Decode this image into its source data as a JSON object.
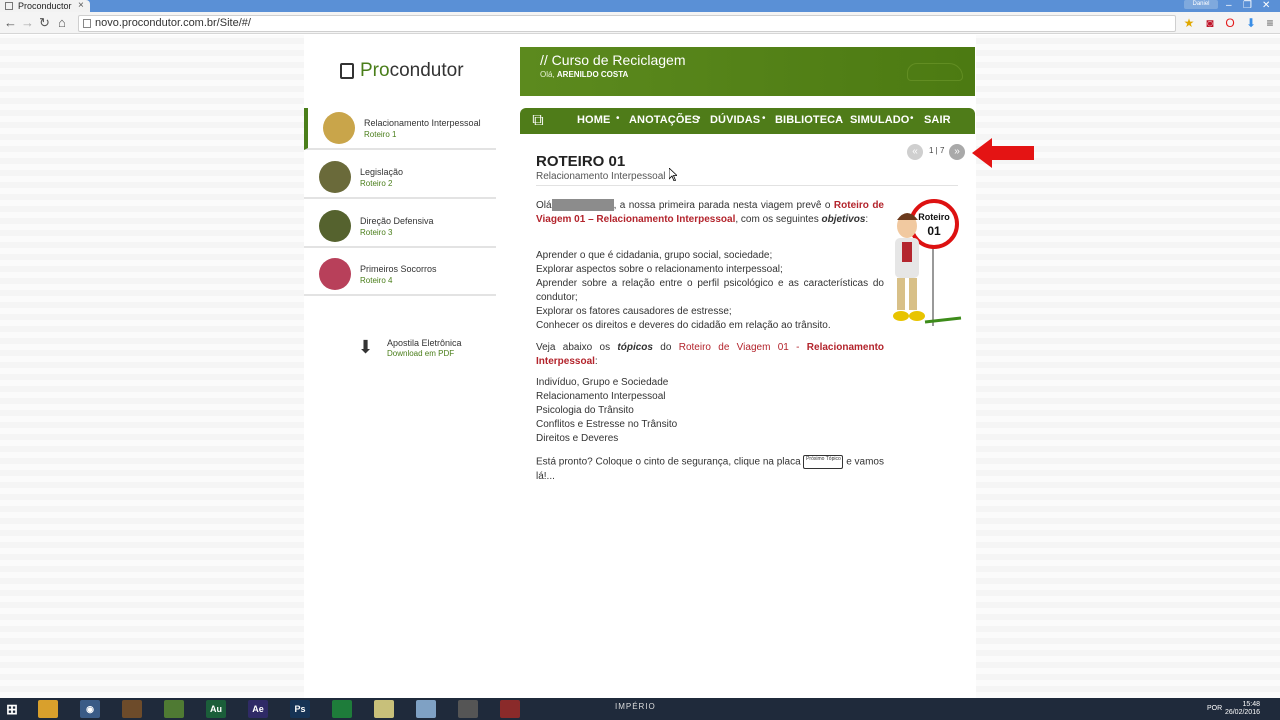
{
  "browser": {
    "tab_title": "Proconductor",
    "tab_close": "×",
    "address": "novo.procondutor.com.br/Site/#/",
    "user_badge": "Daniel",
    "window_controls": [
      "–",
      "❐",
      "✕"
    ]
  },
  "site": {
    "logo_text_green": "Pro",
    "logo_text_dark": "condutor",
    "banner_title": "// Curso de Reciclagem",
    "banner_greeting": "Olá,",
    "banner_user": "ARENILDO COSTA"
  },
  "nav": {
    "items": [
      "HOME",
      "ANOTAÇÕES",
      "DÚVIDAS",
      "BIBLIOTECA",
      "SIMULADO",
      "SAIR"
    ]
  },
  "sidebar": {
    "items": [
      {
        "title": "Relacionamento Interpessoal",
        "subtitle": "Roteiro 1"
      },
      {
        "title": "Legislação",
        "subtitle": "Roteiro 2"
      },
      {
        "title": "Direção Defensiva",
        "subtitle": "Roteiro 3"
      },
      {
        "title": "Primeiros Socorros",
        "subtitle": "Roteiro 4"
      }
    ],
    "download_title": "Apostila Eletrônica",
    "download_sub": "Download em PDF"
  },
  "content": {
    "title": "ROTEIRO 01",
    "subtitle": "Relacionamento Interpessoal",
    "pager": "1 | 7",
    "intro_pre": "Olá",
    "intro_mid": ", a nossa primeira parada nesta viagem prevê o",
    "intro_link": "Roteiro de Viagem 01 – Relacionamento Interpessoal",
    "intro_post": ", com os seguintes",
    "intro_obj": "objetivos",
    "objectives": [
      "Aprender o que é cidadania, grupo social, sociedade;",
      "Explorar aspectos sobre o relacionamento interpessoal;",
      "Aprender sobre a relação entre o perfil psicológico e as características do condutor;",
      "Explorar os fatores causadores de estresse;",
      "Conhecer os direitos e deveres do cidadão em relação ao trânsito."
    ],
    "topics_pre": "Veja abaixo os",
    "topics_word": "tópicos",
    "topics_do": "do",
    "topics_link1": "Roteiro de Viagem 01 -",
    "topics_link2": "Relacionamento Interpessoal",
    "topics": [
      "Indivíduo, Grupo e Sociedade",
      "Relacionamento Interpessoal",
      "Psicologia do Trânsito",
      "Conflitos e Estresse no Trânsito",
      "Direitos e Deveres"
    ],
    "closing_pre": "Está pronto? Coloque o cinto de segurança, clique na placa",
    "closing_post": "e vamos lá!...",
    "placa_text": "Próximo Tópico",
    "sign_line1": "Roteiro",
    "sign_line2": "01"
  },
  "taskbar": {
    "time": "15:48",
    "date": "26/02/2016",
    "lang": "POR",
    "brand": "IMPÉRIO",
    "apps": [
      "",
      "",
      "",
      "",
      "Au",
      "Ae",
      "Ps",
      "",
      "",
      "",
      "",
      ""
    ]
  },
  "colors": {
    "brand_green": "#4f7c19",
    "accent_red": "#b3242c"
  }
}
